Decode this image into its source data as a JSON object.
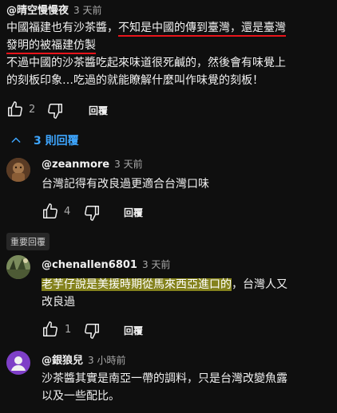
{
  "comment_main": {
    "author": "@晴空慢慢夜",
    "time": "3 天前",
    "line1_a": "中國福建也有沙茶醬，",
    "line1_b": "不知是中國的傳到臺灣，還是臺灣",
    "line2_a": "發明的被福建仿製",
    "line3": "不過中國的沙茶醬吃起來味道很死鹹的，然後會有味覺上",
    "line4": "的刻板印象…吃過的就能瞭解什麼叫作味覺的刻板！",
    "likes": "2",
    "reply_label": "回覆"
  },
  "replies_toggle": {
    "label": "3 則回覆"
  },
  "reply1": {
    "author": "@zeanmore",
    "time": "3 天前",
    "text": "台灣記得有改良過更適合台灣口味",
    "likes": "4",
    "reply_label": "回覆"
  },
  "important_tag": "重要回覆",
  "reply2": {
    "author": "@chenallen6801",
    "time": "3 天前",
    "text_hl": "老芋仔說是美援時期從馬來西亞進口的",
    "text_rest": "，台灣人又",
    "text_line2": "改良過",
    "likes": "1",
    "reply_label": "回覆"
  },
  "reply3": {
    "author": "@銀狼兒",
    "time": "3 小時前",
    "line1": "沙茶醬其實是南亞一帶的調料，只是台灣改變魚露",
    "line2": "以及一些配比。"
  },
  "colors": {
    "background": "#0f0f0f",
    "link_blue": "#3ea6ff",
    "underline_red": "#e8141b",
    "highlight": "#e6e128"
  }
}
